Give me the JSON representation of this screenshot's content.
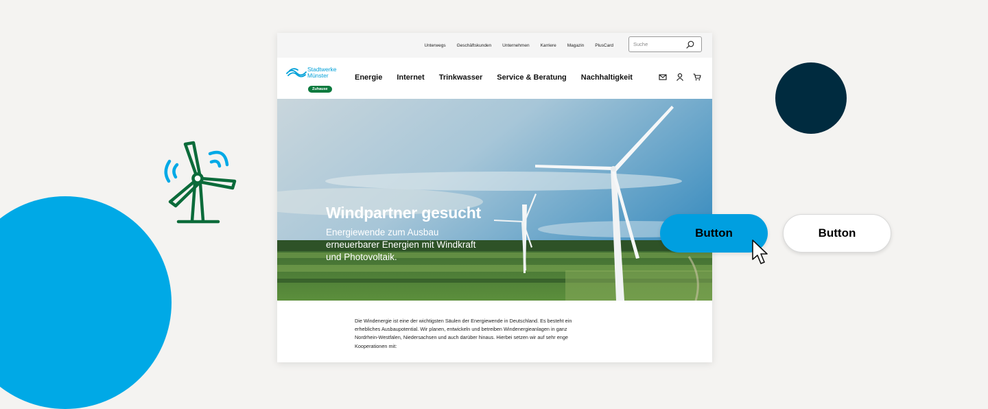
{
  "decor": {
    "blue_circle_color": "#00a9e6",
    "navy_circle_color": "#002b3f",
    "turbine_icon": "wind-turbine-icon",
    "turbine_color": "#0b6b3a",
    "signal_color": "#00a9e6"
  },
  "site": {
    "topbar": {
      "links": [
        "Unterwegs",
        "Geschäftskunden",
        "Unternehmen",
        "Karriere",
        "Magazin",
        "PlusCard"
      ],
      "search_placeholder": "Suche",
      "search_icon": "search-icon"
    },
    "logo": {
      "line1": "Stadtwerke",
      "line2": "Münster",
      "badge": "Zuhause",
      "brand_color": "#00a0d8",
      "badge_color": "#0b7a3e"
    },
    "nav": {
      "items": [
        "Energie",
        "Internet",
        "Trinkwasser",
        "Service & Beratung",
        "Nachhaltigkeit"
      ],
      "icons": [
        "mail-icon",
        "user-icon",
        "cart-icon"
      ]
    },
    "hero": {
      "title": "Windpartner gesucht",
      "subtitle": "Energiewende zum Ausbau erneuerbarer Energien mit Windkraft und Photovoltaik."
    },
    "body_text": "Die Windenergie ist eine der wichtigsten Säulen der Energiewende in Deutschland. Es besteht ein erhebliches Ausbaupotential. Wir planen, entwickeln und betreiben Windenergieanlagen in ganz Nordrhein-Westfalen, Niedersachsen und auch darüber hinaus. Hierbei setzen wir auf sehr enge Kooperationen mit:"
  },
  "buttons": {
    "primary_label": "Button",
    "secondary_label": "Button",
    "primary_color": "#009fe0",
    "cursor_icon": "pointer-cursor-icon"
  }
}
